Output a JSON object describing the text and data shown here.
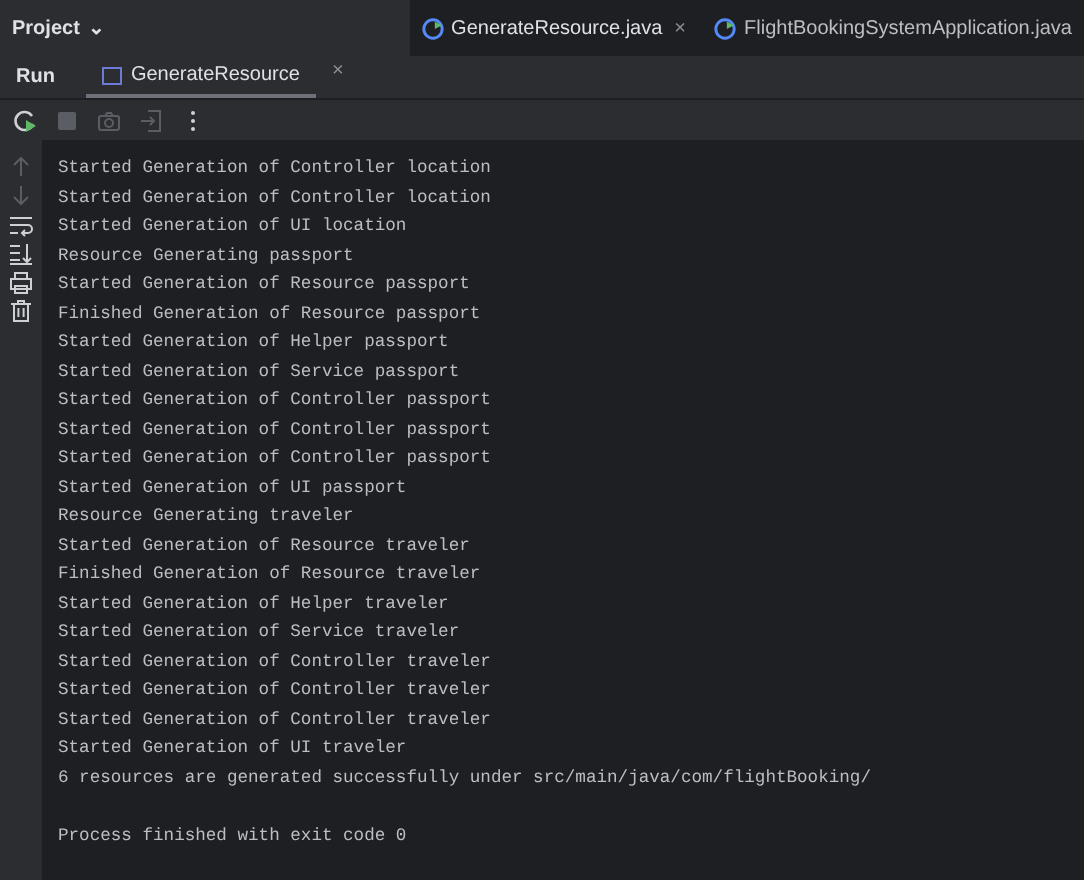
{
  "project_menu": {
    "label": "Project",
    "caret": "⌄"
  },
  "editor_tabs": [
    {
      "label": "GenerateResource.java",
      "selected": true,
      "close": "×"
    },
    {
      "label": "FlightBookingSystemApplication.java",
      "selected": false
    }
  ],
  "run_panel": {
    "title": "Run",
    "tabs": [
      {
        "label": "GenerateResource",
        "selected": true,
        "close": "×"
      }
    ]
  },
  "toolbar": [
    {
      "kind": "rerun",
      "disabled": false
    },
    {
      "kind": "stop",
      "disabled": true
    },
    {
      "kind": "camera",
      "disabled": true
    },
    {
      "kind": "exit",
      "disabled": true
    },
    {
      "kind": "more",
      "disabled": false
    }
  ],
  "gutter": [
    {
      "kind": "up",
      "disabled": true
    },
    {
      "kind": "down",
      "disabled": true
    },
    {
      "kind": "wrap",
      "disabled": false
    },
    {
      "kind": "scroll",
      "disabled": false
    },
    {
      "kind": "print",
      "disabled": false
    },
    {
      "kind": "trash",
      "disabled": false
    }
  ],
  "console_lines": [
    "Started Generation of Controller location",
    "Started Generation of Controller location",
    "Started Generation of UI location",
    "Resource Generating passport",
    "Started Generation of Resource passport",
    "Finished Generation of Resource passport",
    "Started Generation of Helper passport",
    "Started Generation of Service passport",
    "Started Generation of Controller passport",
    "Started Generation of Controller passport",
    "Started Generation of Controller passport",
    "Started Generation of UI passport",
    "Resource Generating traveler",
    "Started Generation of Resource traveler",
    "Finished Generation of Resource traveler",
    "Started Generation of Helper traveler",
    "Started Generation of Service traveler",
    "Started Generation of Controller traveler",
    "Started Generation of Controller traveler",
    "Started Generation of Controller traveler",
    "Started Generation of UI traveler",
    "6 resources are generated successfully under src/main/java/com/flightBooking/"
  ],
  "exit_message": "Process finished with exit code 0"
}
